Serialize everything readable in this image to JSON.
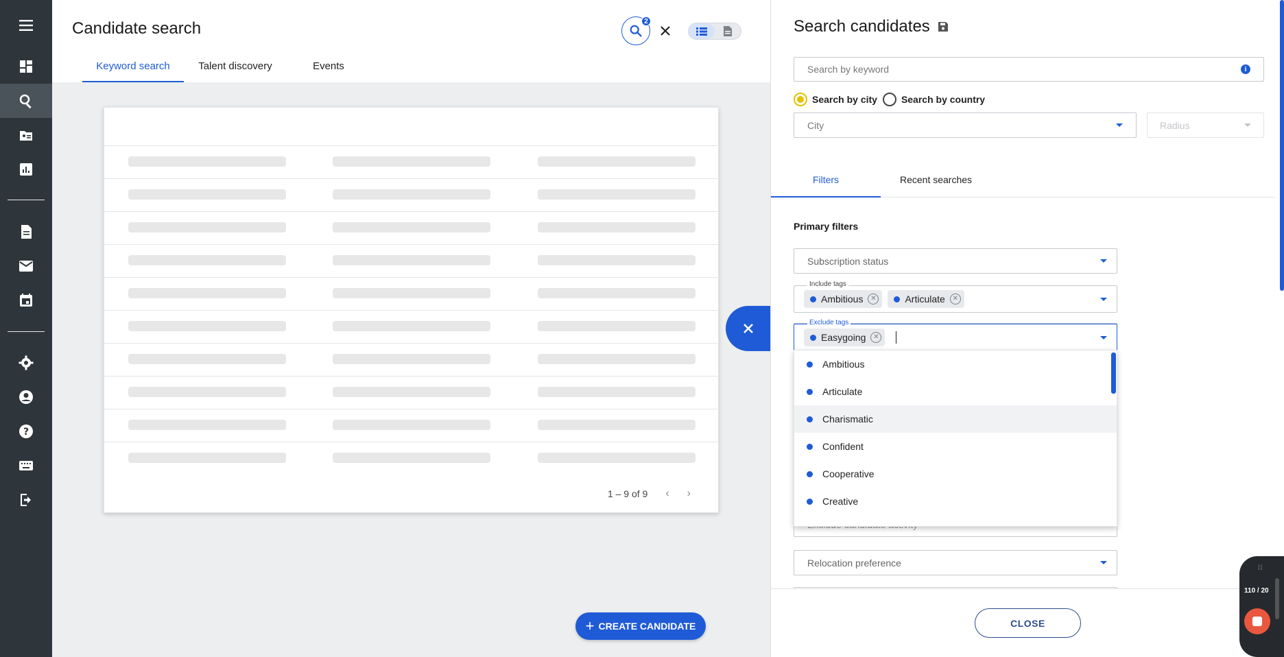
{
  "main": {
    "title": "Candidate search",
    "tabs": [
      {
        "label": "Keyword search"
      },
      {
        "label": "Talent discovery"
      },
      {
        "label": "Events"
      }
    ],
    "search_badge": "2",
    "pagination": "1 – 9 of 9",
    "create_button": "CREATE CANDIDATE"
  },
  "panel": {
    "title": "Search candidates",
    "keyword_placeholder": "Search by keyword",
    "radio_city": "Search by city",
    "radio_country": "Search by country",
    "city_placeholder": "City",
    "radius_placeholder": "Radius",
    "tabs": [
      {
        "label": "Filters"
      },
      {
        "label": "Recent searches"
      }
    ],
    "primary_filters": "Primary filters",
    "subscription_status": "Subscription status",
    "include_tags": {
      "label": "Include tags",
      "chips": [
        "Ambitious",
        "Articulate"
      ]
    },
    "exclude_tags": {
      "label": "Exclude tags",
      "chips": [
        "Easygoing"
      ]
    },
    "dropdown_options": [
      "Ambitious",
      "Articulate",
      "Charismatic",
      "Confident",
      "Cooperative",
      "Creative"
    ],
    "hidden_field": "Exclude candidate activity",
    "relocation_preference": "Relocation preference",
    "close_button": "CLOSE"
  },
  "recorder": {
    "count": "110 / 20"
  },
  "colors": {
    "accent": "#1f5bd6",
    "nav_bg": "#2e353b",
    "radio_selected": "#e2c200"
  }
}
